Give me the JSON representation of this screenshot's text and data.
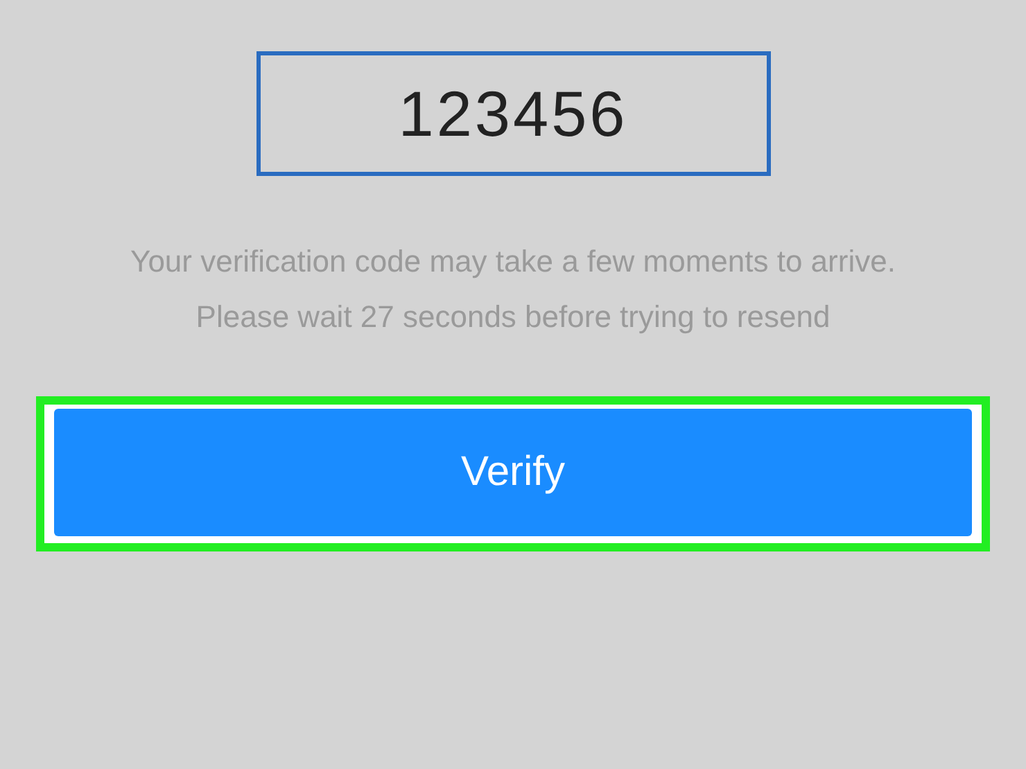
{
  "code_field": {
    "value": "123456"
  },
  "messages": [
    "Your verification code may take a few moments to arrive.",
    "Please wait 27 seconds before trying to resend"
  ],
  "verify_button": {
    "label": "Verify",
    "highlighted": true
  }
}
